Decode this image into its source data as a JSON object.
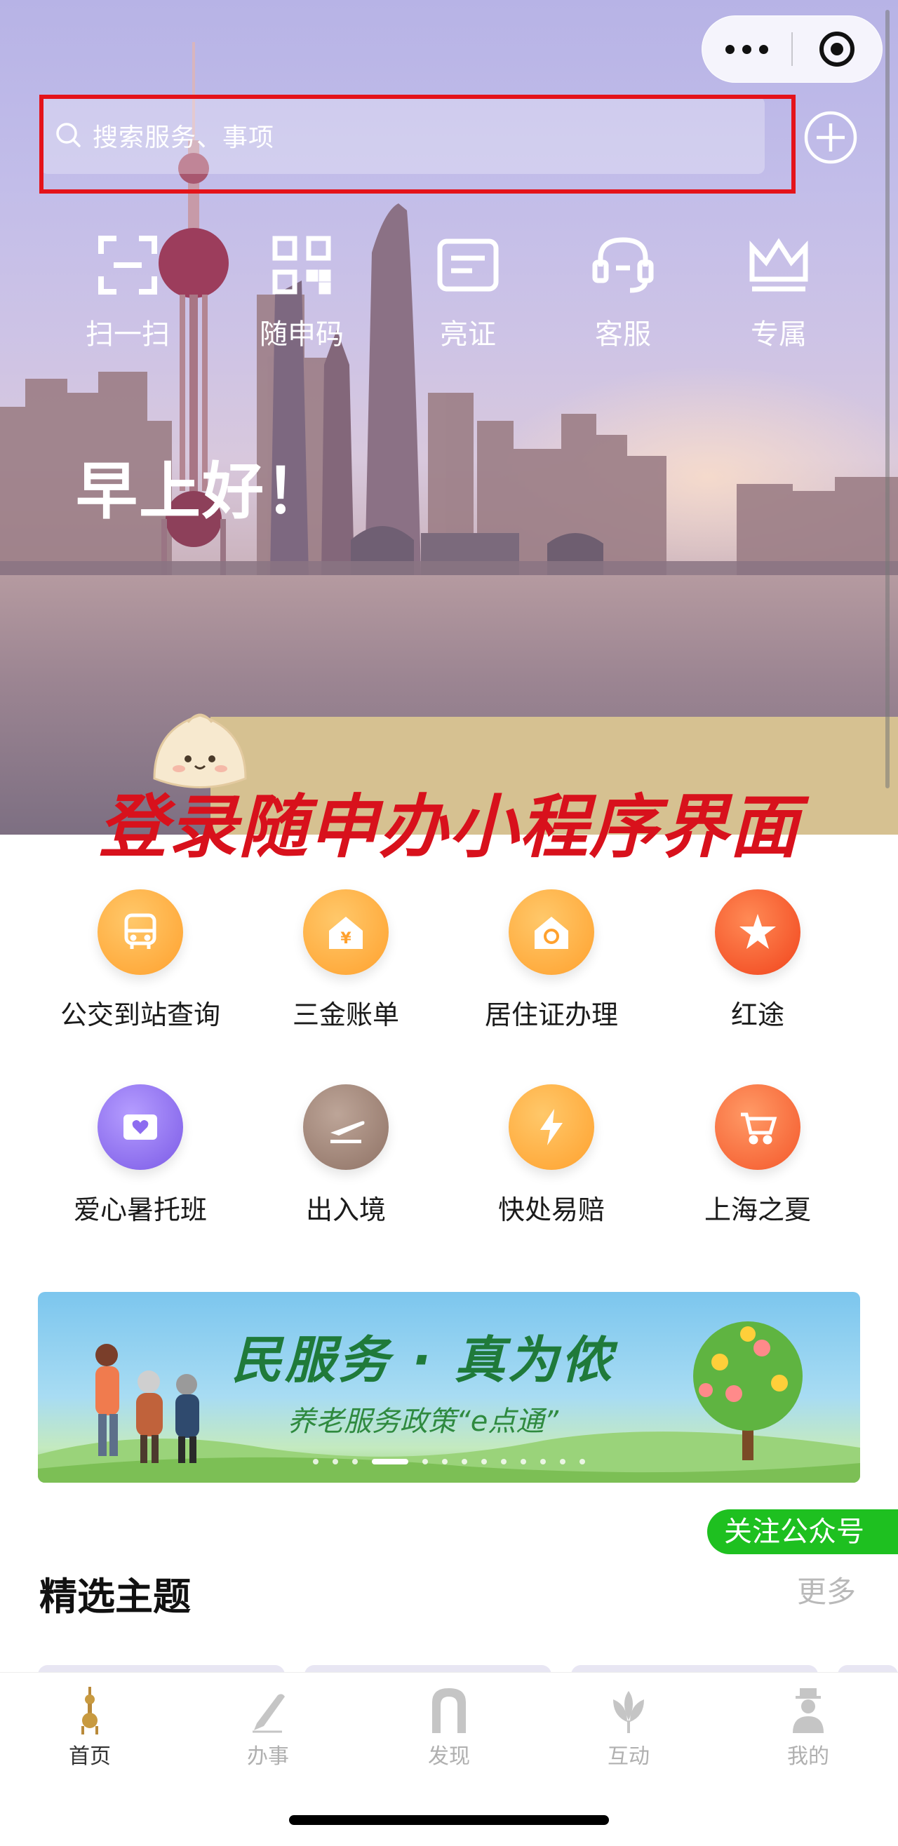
{
  "colors": {
    "annotation_red": "#e4131a",
    "accent_green": "#1ec020",
    "banner_green": "#1f7a3a",
    "tab_inactive": "#b0b0b0"
  },
  "search": {
    "placeholder": "搜索服务、事项",
    "icon": "search-icon"
  },
  "capsule": {
    "more_icon": "more-dots-icon",
    "close_icon": "target-icon"
  },
  "quick_actions": [
    {
      "label": "扫一扫",
      "icon": "scan-icon"
    },
    {
      "label": "随申码",
      "icon": "qr-code-icon"
    },
    {
      "label": "亮证",
      "icon": "id-card-icon"
    },
    {
      "label": "客服",
      "icon": "headset-icon"
    },
    {
      "label": "专属",
      "icon": "crown-icon"
    }
  ],
  "greeting": "早上好！",
  "overlay_title": "登录随申办小程序界面",
  "services": [
    {
      "label": "公交到站查询",
      "icon": "bus-icon",
      "color": "#ffa93b"
    },
    {
      "label": "三金账单",
      "icon": "house-yen-icon",
      "color": "#ffa93b"
    },
    {
      "label": "居住证办理",
      "icon": "house-shield-icon",
      "color": "#ffa93b"
    },
    {
      "label": "红途",
      "icon": "star-flag-icon",
      "color": "#f4552a"
    },
    {
      "label": "爱心暑托班",
      "icon": "heart-card-icon",
      "color": "#8d6cf0"
    },
    {
      "label": "出入境",
      "icon": "plane-icon",
      "color": "#a08577"
    },
    {
      "label": "快处易赔",
      "icon": "lightning-icon",
      "color": "#ffa93b"
    },
    {
      "label": "上海之夏",
      "icon": "cart-icon",
      "color": "#f86a3a"
    }
  ],
  "banner": {
    "headline": "民服务 · 真为侬",
    "subline": "养老服务政策“e点通”",
    "slides": 13,
    "active_slide": 4
  },
  "follow_button": "关注公众号",
  "section": {
    "title": "精选主题",
    "more": "更多"
  },
  "tabs": [
    {
      "label": "首页",
      "icon": "pearl-tower-icon",
      "active": true
    },
    {
      "label": "办事",
      "icon": "pen-icon",
      "active": false
    },
    {
      "label": "发现",
      "icon": "arch-icon",
      "active": false
    },
    {
      "label": "互动",
      "icon": "magnolia-icon",
      "active": false
    },
    {
      "label": "我的",
      "icon": "person-icon",
      "active": false
    }
  ]
}
